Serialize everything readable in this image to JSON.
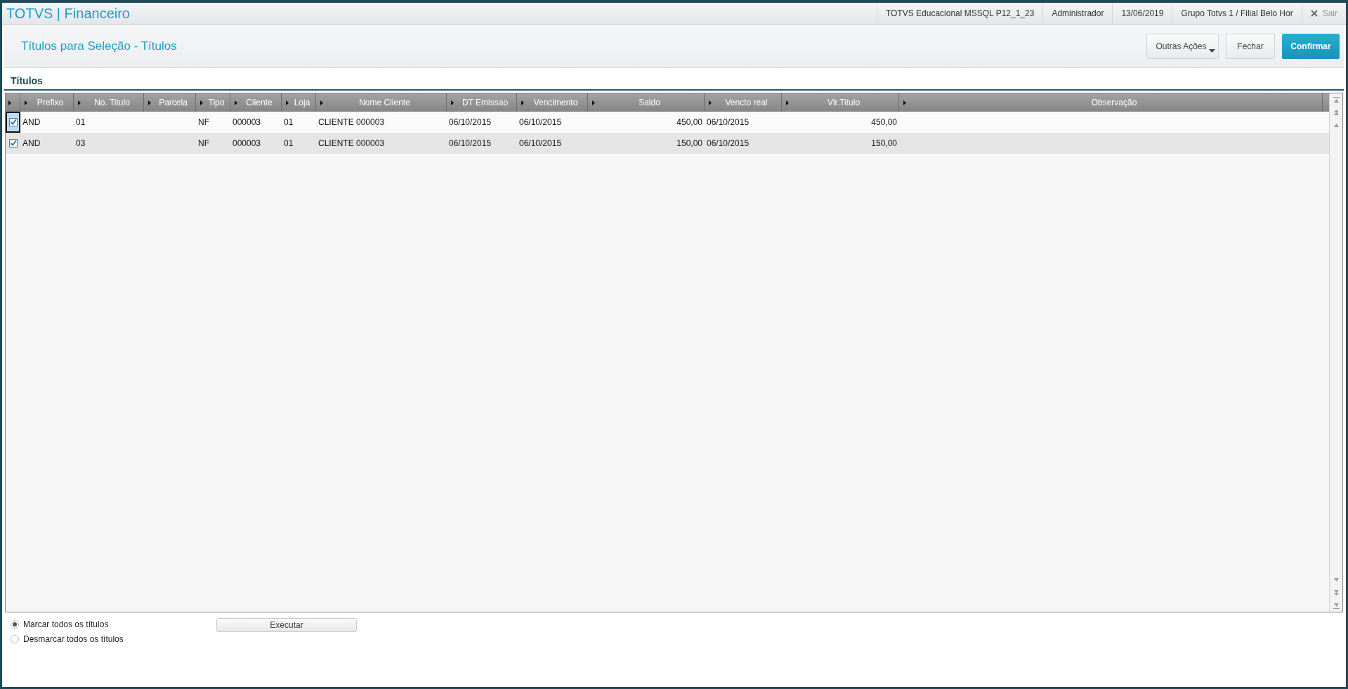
{
  "app_title": "TOTVS | Financeiro",
  "header_info": [
    "TOTVS Educacional MSSQL P12_1_23",
    "Administrador",
    "13/06/2019",
    "Grupo Totvs 1 / Filial Belo Hor"
  ],
  "exit_label": "Sair",
  "page_title": "Títulos para Seleção - Títulos",
  "actions": [
    {
      "label": "Outras Ações",
      "kind": "menu"
    },
    {
      "label": "Fechar",
      "kind": "plain"
    },
    {
      "label": "Confirmar",
      "kind": "primary"
    }
  ],
  "section_title": "Títulos",
  "table": {
    "columns": [
      {
        "label": "Prefixo",
        "kind": "text"
      },
      {
        "label": "No. Titulo",
        "kind": "text"
      },
      {
        "label": "Parcela",
        "kind": "text"
      },
      {
        "label": "Tipo",
        "kind": "text"
      },
      {
        "label": "Cliente",
        "kind": "text"
      },
      {
        "label": "Loja",
        "kind": "text"
      },
      {
        "label": "Nome Cliente",
        "kind": "text"
      },
      {
        "label": "DT Emissao",
        "kind": "text"
      },
      {
        "label": "Vencimento",
        "kind": "text"
      },
      {
        "label": "Saldo",
        "kind": "amount"
      },
      {
        "label": "Vencto real",
        "kind": "text"
      },
      {
        "label": "Vlr.Titulo",
        "kind": "amount"
      },
      {
        "label": "Observação",
        "kind": "text"
      }
    ],
    "rows": [
      {
        "checked": true,
        "focused": true,
        "cells": [
          "AND",
          "01",
          "",
          "NF",
          "000003",
          "01",
          "CLIENTE 000003",
          "06/10/2015",
          "06/10/2015",
          "450,00",
          "06/10/2015",
          "450,00",
          ""
        ]
      },
      {
        "checked": true,
        "focused": false,
        "cells": [
          "AND",
          "03",
          "",
          "NF",
          "000003",
          "01",
          "CLIENTE 000003",
          "06/10/2015",
          "06/10/2015",
          "150,00",
          "06/10/2015",
          "150,00",
          ""
        ]
      }
    ]
  },
  "options": [
    {
      "label": "Marcar todos os títulos",
      "selected": true
    },
    {
      "label": "Desmarcar todos os títulos",
      "selected": false
    }
  ],
  "execute_button": "Executar"
}
